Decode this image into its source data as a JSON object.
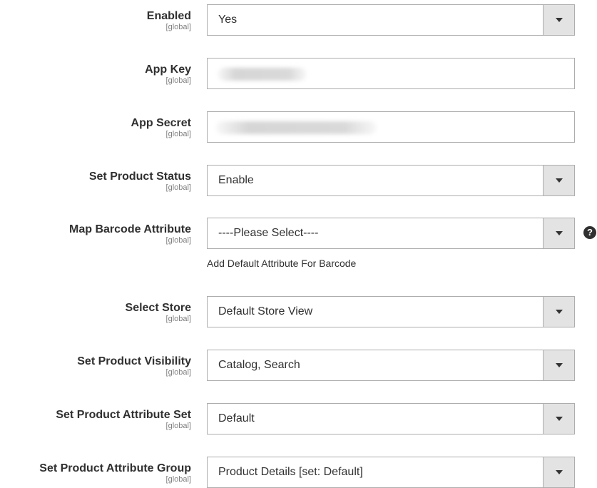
{
  "fields": [
    {
      "label": "Enabled",
      "scope": "[global]",
      "type": "select",
      "value": "Yes"
    },
    {
      "label": "App Key",
      "scope": "[global]",
      "type": "text",
      "value": ""
    },
    {
      "label": "App Secret",
      "scope": "[global]",
      "type": "text",
      "value": ""
    },
    {
      "label": "Set Product Status",
      "scope": "[global]",
      "type": "select",
      "value": "Enable"
    },
    {
      "label": "Map Barcode Attribute",
      "scope": "[global]",
      "type": "select",
      "value": "----Please Select----",
      "note": "Add Default Attribute For Barcode",
      "help_icon": "question-circle-icon"
    },
    {
      "label": "Select Store",
      "scope": "[global]",
      "type": "select",
      "value": "Default Store View"
    },
    {
      "label": "Set Product Visibility",
      "scope": "[global]",
      "type": "select",
      "value": "Catalog, Search"
    },
    {
      "label": "Set Product Attribute Set",
      "scope": "[global]",
      "type": "select",
      "value": "Default"
    },
    {
      "label": "Set Product Attribute Group",
      "scope": "[global]",
      "type": "select",
      "value": "Product Details [set: Default]"
    }
  ],
  "icons": {
    "dropdown": "chevron-down-icon",
    "help": "question-circle-icon"
  }
}
